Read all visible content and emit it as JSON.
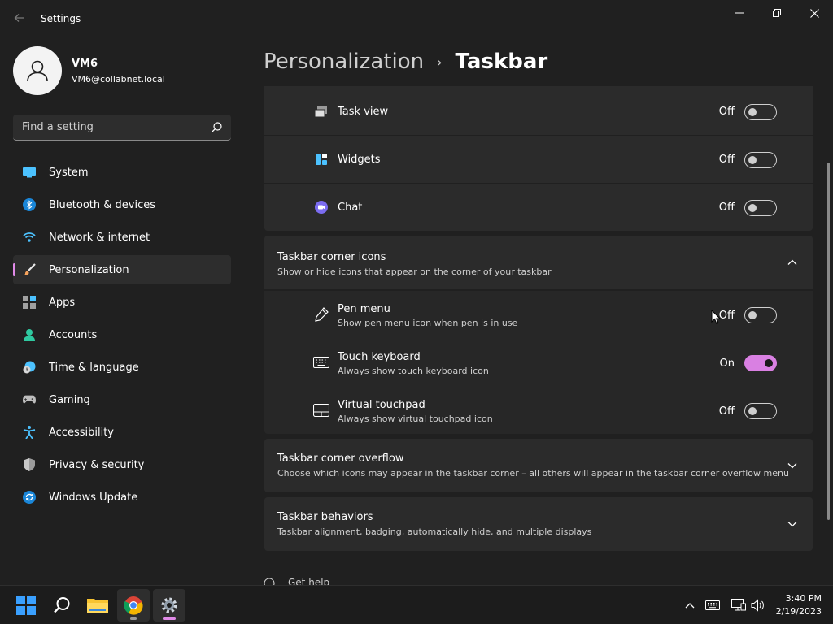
{
  "window": {
    "title": "Settings"
  },
  "profile": {
    "name": "VM6",
    "email": "VM6@collabnet.local"
  },
  "search": {
    "placeholder": "Find a setting"
  },
  "sidebar": {
    "items": [
      {
        "label": "System",
        "icon": "monitor-icon"
      },
      {
        "label": "Bluetooth & devices",
        "icon": "bluetooth-icon"
      },
      {
        "label": "Network & internet",
        "icon": "wifi-icon"
      },
      {
        "label": "Personalization",
        "icon": "brush-icon"
      },
      {
        "label": "Apps",
        "icon": "apps-icon"
      },
      {
        "label": "Accounts",
        "icon": "person-icon"
      },
      {
        "label": "Time & language",
        "icon": "clock-globe-icon"
      },
      {
        "label": "Gaming",
        "icon": "gamepad-icon"
      },
      {
        "label": "Accessibility",
        "icon": "accessibility-icon"
      },
      {
        "label": "Privacy & security",
        "icon": "shield-icon"
      },
      {
        "label": "Windows Update",
        "icon": "update-icon"
      }
    ],
    "active": "Personalization"
  },
  "breadcrumb": {
    "parent": "Personalization",
    "separator": "›",
    "current": "Taskbar"
  },
  "taskbar_items": [
    {
      "title": "Task view",
      "state": "Off"
    },
    {
      "title": "Widgets",
      "state": "Off"
    },
    {
      "title": "Chat",
      "state": "Off"
    }
  ],
  "corner_icons": {
    "title": "Taskbar corner icons",
    "subtitle": "Show or hide icons that appear on the corner of your taskbar",
    "items": [
      {
        "title": "Pen menu",
        "subtitle": "Show pen menu icon when pen is in use",
        "state": "Off"
      },
      {
        "title": "Touch keyboard",
        "subtitle": "Always show touch keyboard icon",
        "state": "On"
      },
      {
        "title": "Virtual touchpad",
        "subtitle": "Always show virtual touchpad icon",
        "state": "Off"
      }
    ]
  },
  "corner_overflow": {
    "title": "Taskbar corner overflow",
    "subtitle": "Choose which icons may appear in the taskbar corner – all others will appear in the taskbar corner overflow menu"
  },
  "behaviors": {
    "title": "Taskbar behaviors",
    "subtitle": "Taskbar alignment, badging, automatically hide, and multiple displays"
  },
  "footer": {
    "get_help": "Get help"
  },
  "system_taskbar": {
    "time": "3:40 PM",
    "date": "2/19/2023",
    "accent": "#e08ae8"
  }
}
